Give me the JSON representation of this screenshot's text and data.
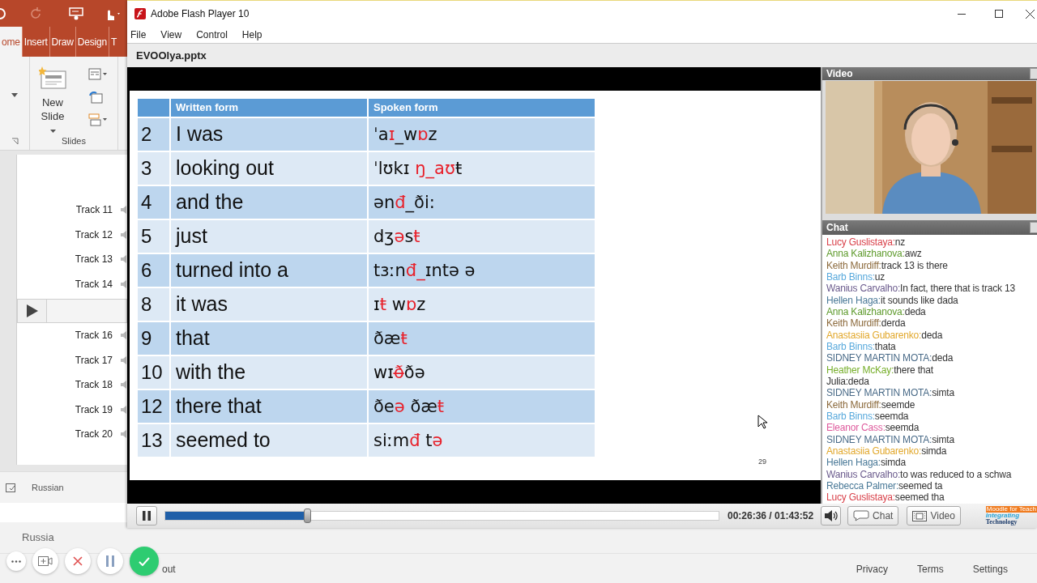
{
  "powerpoint": {
    "ribbon_tabs": [
      {
        "label": "ome",
        "selected": true
      },
      {
        "label": "Insert",
        "selected": false
      },
      {
        "label": "Draw",
        "selected": false
      },
      {
        "label": "Design",
        "selected": false
      },
      {
        "label": "T",
        "selected": false
      }
    ],
    "new_slide": "New Slide",
    "group_label": "Slides",
    "tracks_before": [
      "Track 11",
      "Track 12",
      "Track 13",
      "Track 14"
    ],
    "tracks_after": [
      "Track 16",
      "Track 17",
      "Track 18",
      "Track 19",
      "Track 20"
    ],
    "language": "Russian"
  },
  "web_page": {
    "heading": "Russia",
    "footer_fragment": "out",
    "footer_links": [
      "Privacy",
      "Terms",
      "Settings"
    ]
  },
  "flash": {
    "title": "Adobe Flash Player 10",
    "menu": [
      "File",
      "View",
      "Control",
      "Help"
    ],
    "filename": "EVOOlya.pptx",
    "slide": {
      "columns": [
        "Written form",
        "Spoken form"
      ],
      "page_number": "29",
      "rows": [
        {
          "number": "2",
          "written": "I was",
          "spoken": [
            {
              "text": "ˈa",
              "marked": false
            },
            {
              "text": "ɪ",
              "marked": true
            },
            {
              "text": "_w",
              "marked": false
            },
            {
              "text": "ɒ",
              "marked": true
            },
            {
              "text": "z",
              "marked": false
            }
          ]
        },
        {
          "number": "3",
          "written": "looking out",
          "spoken": [
            {
              "text": "ˈlʊkɪ ",
              "marked": false
            },
            {
              "text": "ŋ_aʊ",
              "marked": true
            },
            {
              "text": "ŧ",
              "marked": false
            }
          ]
        },
        {
          "number": "4",
          "written": "and the",
          "spoken": [
            {
              "text": "ən",
              "marked": false
            },
            {
              "text": "đ",
              "marked": true
            },
            {
              "text": "_ði:",
              "marked": false
            }
          ]
        },
        {
          "number": "5",
          "written": "just",
          "spoken": [
            {
              "text": "dʒ",
              "marked": false
            },
            {
              "text": "ə",
              "marked": true
            },
            {
              "text": "s",
              "marked": false
            },
            {
              "text": "ŧ",
              "marked": true
            }
          ]
        },
        {
          "number": "6",
          "written": "turned into a",
          "spoken": [
            {
              "text": "tɜːn",
              "marked": false
            },
            {
              "text": "đ_",
              "marked": true
            },
            {
              "text": "ɪntə ə",
              "marked": false
            }
          ]
        },
        {
          "number": "8",
          "written": "it was",
          "spoken": [
            {
              "text": "ɪ",
              "marked": false
            },
            {
              "text": "ŧ",
              "marked": true
            },
            {
              "text": " w",
              "marked": false
            },
            {
              "text": "ɒ",
              "marked": true
            },
            {
              "text": "z",
              "marked": false
            }
          ]
        },
        {
          "number": "9",
          "written": "that",
          "spoken": [
            {
              "text": "ðæ",
              "marked": false
            },
            {
              "text": "ŧ",
              "marked": true
            }
          ]
        },
        {
          "number": "10",
          "written": "with the",
          "spoken": [
            {
              "text": "wɪ",
              "marked": false
            },
            {
              "text": "ð̶",
              "marked": true
            },
            {
              "text": "ðə",
              "marked": false
            }
          ]
        },
        {
          "number": "12",
          "written": "there that",
          "spoken": [
            {
              "text": "ðe",
              "marked": false
            },
            {
              "text": "ə",
              "marked": true
            },
            {
              "text": " ðæ",
              "marked": false
            },
            {
              "text": "ŧ",
              "marked": true
            }
          ]
        },
        {
          "number": "13",
          "written": "seemed to",
          "spoken": [
            {
              "text": "siːm",
              "marked": false
            },
            {
              "text": "đ",
              "marked": true
            },
            {
              "text": " t",
              "marked": false
            },
            {
              "text": "ə",
              "marked": true
            }
          ]
        }
      ]
    },
    "video": {
      "title": "Video",
      "kind": "picture"
    },
    "chat": {
      "title": "Chat",
      "messages": [
        {
          "name": "Lucy Guslistaya:",
          "color": "#d9414a",
          "text": "nz"
        },
        {
          "name": "Anna Kalizhanova:",
          "color": "#5e9a2c",
          "text": "awz"
        },
        {
          "name": "Keith Murdiff:",
          "color": "#8c6a3c",
          "text": "track 13 is there"
        },
        {
          "name": "Barb Binns:",
          "color": "#58a9dc",
          "text": "uz"
        },
        {
          "name": "Wanius Carvalho:",
          "color": "#6a5a8c",
          "text": "In fact, there that is track 13"
        },
        {
          "name": "Hellen Haga:",
          "color": "#4b7a98",
          "text": "it sounds like dada"
        },
        {
          "name": "Anna Kalizhanova:",
          "color": "#5e9a2c",
          "text": "deda"
        },
        {
          "name": "Keith Murdiff:",
          "color": "#8c6a3c",
          "text": "derda"
        },
        {
          "name": "Anastasiia Gubarenko:",
          "color": "#e2a82c",
          "text": "deda"
        },
        {
          "name": "Barb Binns:",
          "color": "#58a9dc",
          "text": "thata"
        },
        {
          "name": " SIDNEY MARTIN MOTA:",
          "color": "#4a6b88",
          "text": "deda"
        },
        {
          "name": "Heather McKay:",
          "color": "#76ae2a",
          "text": "there that"
        },
        {
          "name": "Julia:",
          "color": "#333333",
          "text": "deda"
        },
        {
          "name": " SIDNEY MARTIN MOTA:",
          "color": "#4a6b88",
          "text": "simta"
        },
        {
          "name": "Keith Murdiff:",
          "color": "#8c6a3c",
          "text": "seemde"
        },
        {
          "name": "Barb Binns:",
          "color": "#58a9dc",
          "text": "seemda"
        },
        {
          "name": "Eleanor Cass:",
          "color": "#de5a9c",
          "text": "seemda"
        },
        {
          "name": " SIDNEY MARTIN MOTA:",
          "color": "#4a6b88",
          "text": "simta"
        },
        {
          "name": "Anastasiia Gubarenko:",
          "color": "#e2a82c",
          "text": "simda"
        },
        {
          "name": "Hellen Haga:",
          "color": "#4b7a98",
          "text": "simda"
        },
        {
          "name": "Wanius Carvalho:",
          "color": "#6a5a8c",
          "text": "to was reduced to a schwa"
        },
        {
          "name": "Rebecca Palmer:",
          "color": "#4b7a98",
          "text": "seemed ta"
        },
        {
          "name": "Lucy Guslistaya:",
          "color": "#d9414a",
          "text": "seemed tha"
        }
      ]
    },
    "player": {
      "playing": true,
      "level": 0.257,
      "time": "00:26:36 / 01:43:52",
      "buttons": [
        {
          "kind": "chat",
          "label": "Chat"
        },
        {
          "kind": "video",
          "label": "Video"
        }
      ],
      "logo": [
        "Moodle for Teach",
        "Integrating",
        "Technology"
      ]
    }
  }
}
